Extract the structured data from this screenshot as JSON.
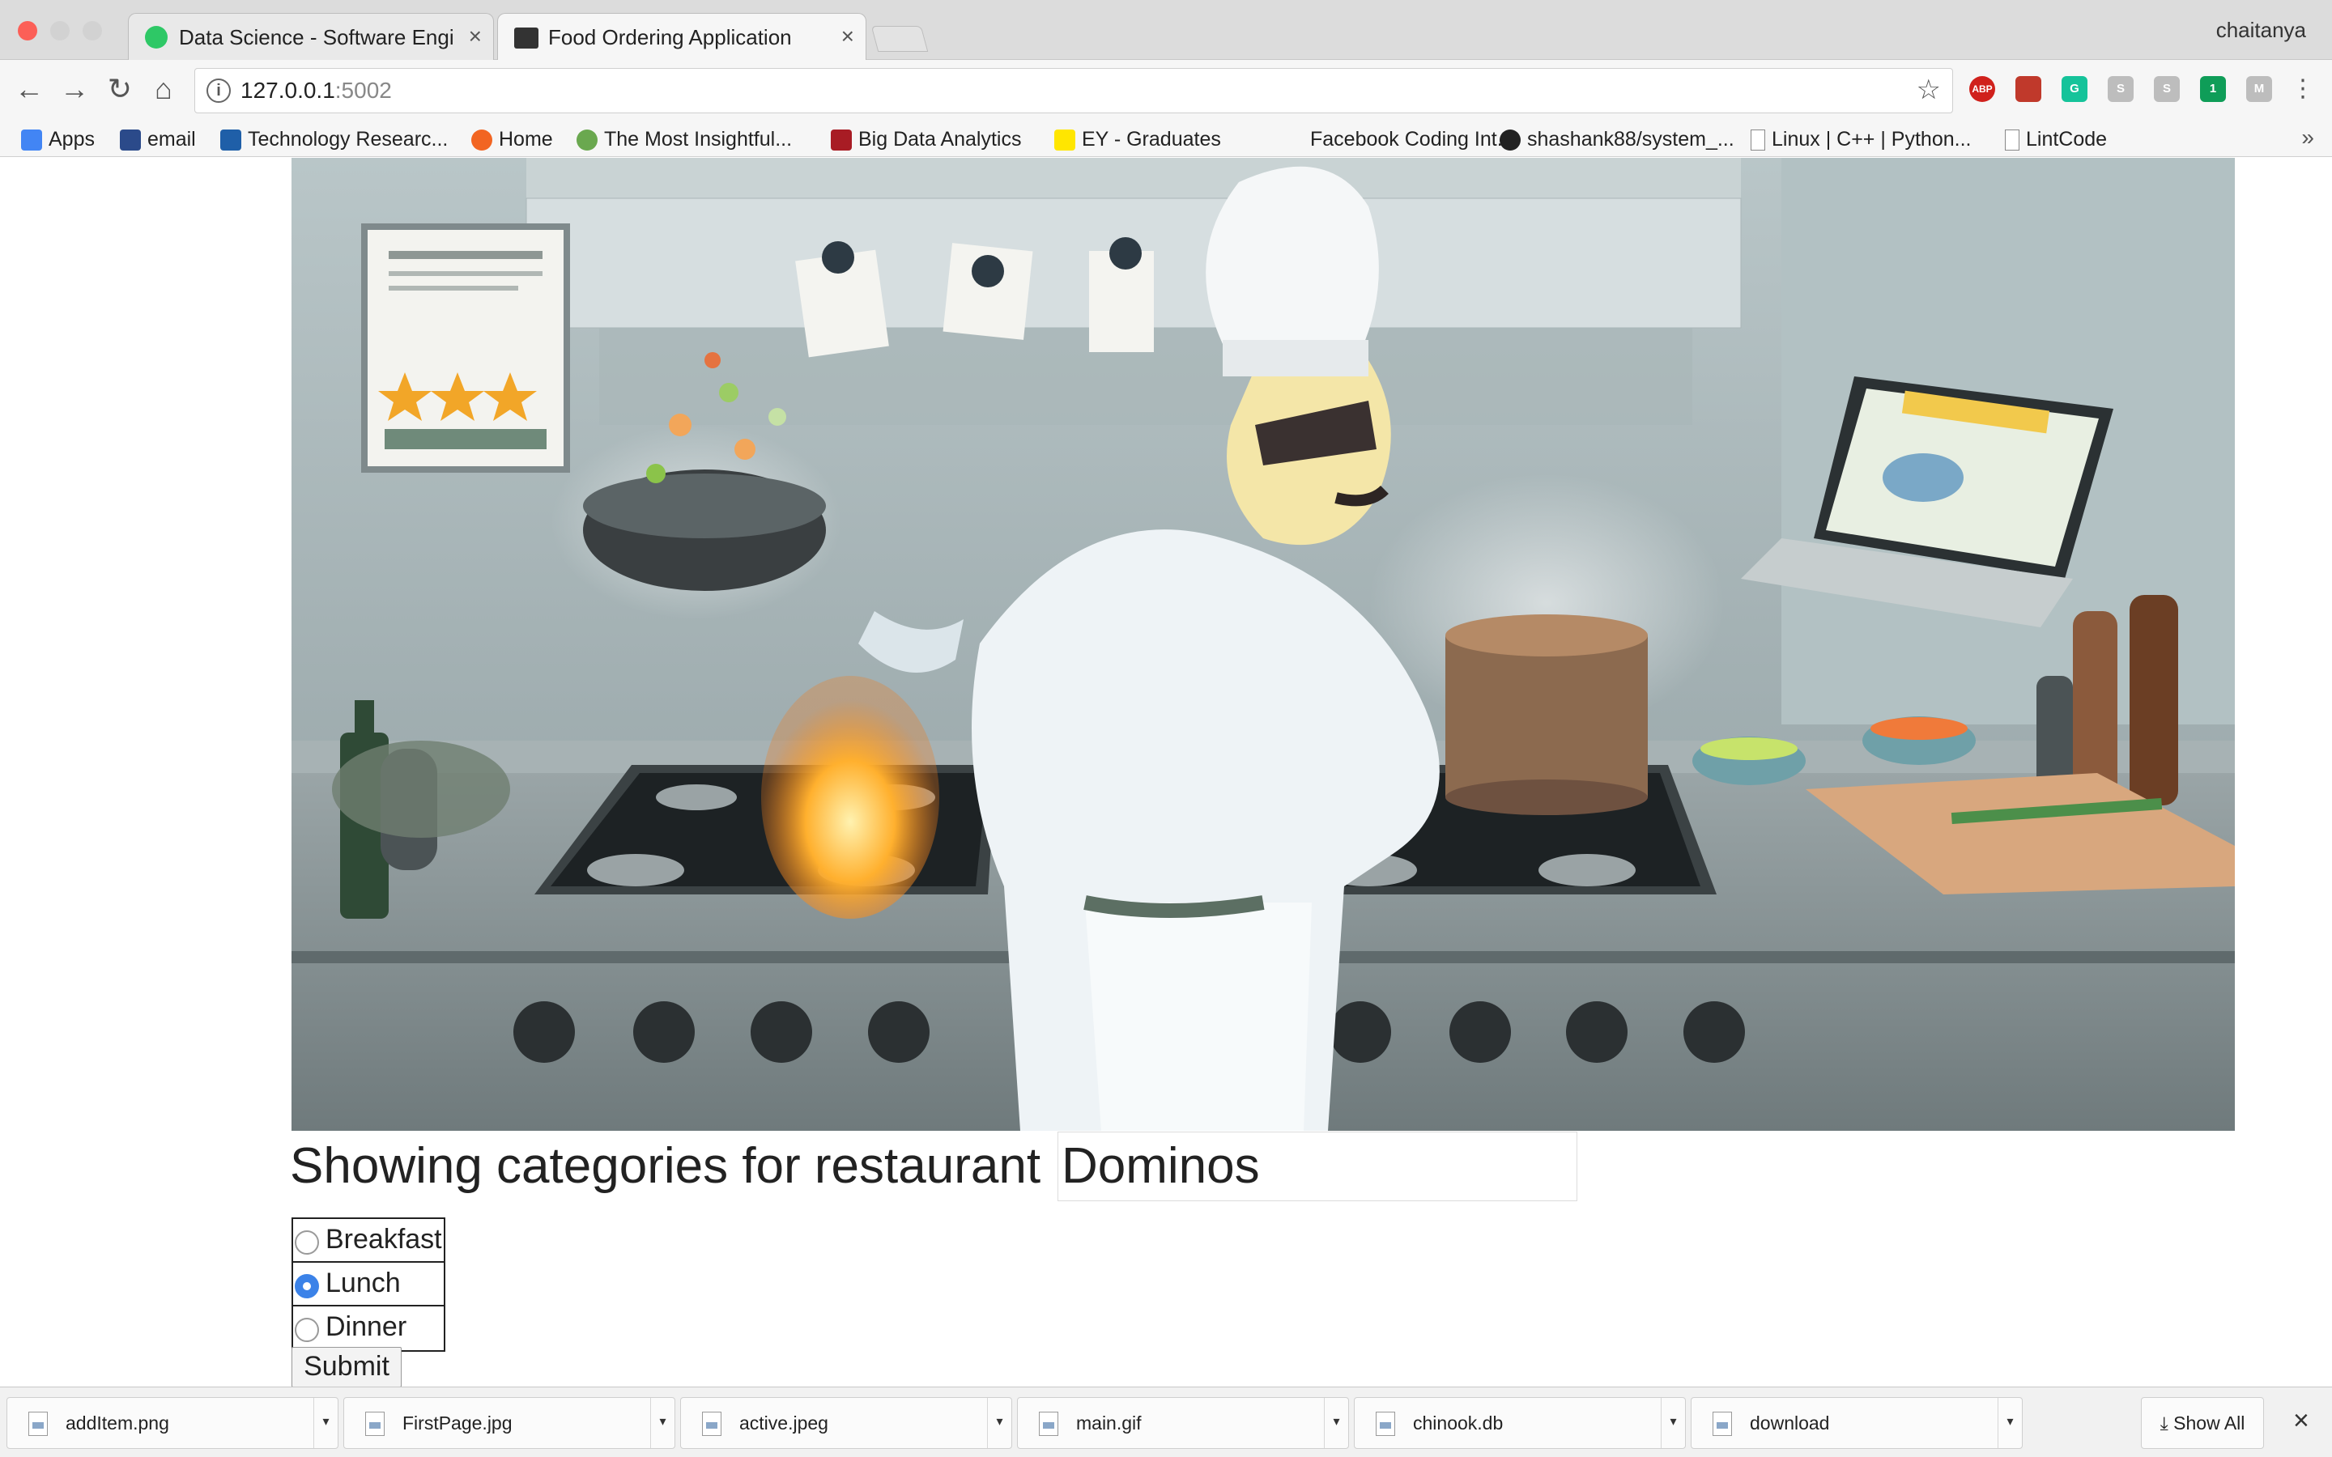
{
  "browser": {
    "tabs": [
      {
        "title": "Data Science - Software Engin",
        "active": false
      },
      {
        "title": "Food Ordering Application",
        "active": true
      }
    ],
    "profile_name": "chaitanya",
    "address": {
      "host": "127.0.0.1",
      "port": ":5002"
    },
    "extensions": [
      {
        "name": "adblock-plus-icon",
        "label": "ABP",
        "color": "#d0211c"
      },
      {
        "name": "bookmark-ext-icon",
        "label": "",
        "color": "#c0392b"
      },
      {
        "name": "grammarly-icon",
        "label": "G",
        "color": "#15c39a"
      },
      {
        "name": "extension-s-icon",
        "label": "S",
        "color": "#bdbdbd"
      },
      {
        "name": "skype-icon",
        "label": "S",
        "color": "#bdbdbd"
      },
      {
        "name": "hangouts-icon",
        "label": "1",
        "color": "#0f9d58"
      },
      {
        "name": "extension-m-icon",
        "label": "M",
        "color": "#bdbdbd"
      }
    ]
  },
  "bookmarks": [
    {
      "label": "Apps",
      "icon": "apps-grid-icon",
      "color": "#4285f4"
    },
    {
      "label": "email",
      "icon": "ms-email-icon",
      "color": "#2b4a8a"
    },
    {
      "label": "Technology Researc...",
      "icon": "gartner-icon",
      "color": "#1f5fa8"
    },
    {
      "label": "Home",
      "icon": "home-arc-icon",
      "color": "#f26522"
    },
    {
      "label": "The Most Insightful...",
      "icon": "tree-icon",
      "color": "#6aa84f"
    },
    {
      "label": "Big Data Analytics",
      "icon": "shield-icon",
      "color": "#a81c24"
    },
    {
      "label": "EY - Graduates",
      "icon": "ey-icon",
      "color": "#ffe600"
    },
    {
      "label": "Facebook Coding Int...",
      "icon": "blank-icon",
      "color": "#f6f6f6"
    },
    {
      "label": "shashank88/system_...",
      "icon": "github-icon",
      "color": "#222222"
    },
    {
      "label": "Linux | C++ | Python...",
      "icon": "page-icon",
      "color": "#ffffff"
    },
    {
      "label": "LintCode",
      "icon": "page-icon",
      "color": "#ffffff"
    }
  ],
  "page": {
    "heading": "Showing categories for restaurant",
    "restaurant": "Dominos",
    "meal_options": [
      {
        "label": "Breakfast",
        "checked": false
      },
      {
        "label": "Lunch",
        "checked": true
      },
      {
        "label": "Dinner",
        "checked": false
      }
    ],
    "submit_label": "Submit"
  },
  "downloads": {
    "items": [
      "addItem.png",
      "FirstPage.jpg",
      "active.jpeg",
      "main.gif",
      "chinook.db",
      "download"
    ],
    "show_all_label": "Show All"
  }
}
